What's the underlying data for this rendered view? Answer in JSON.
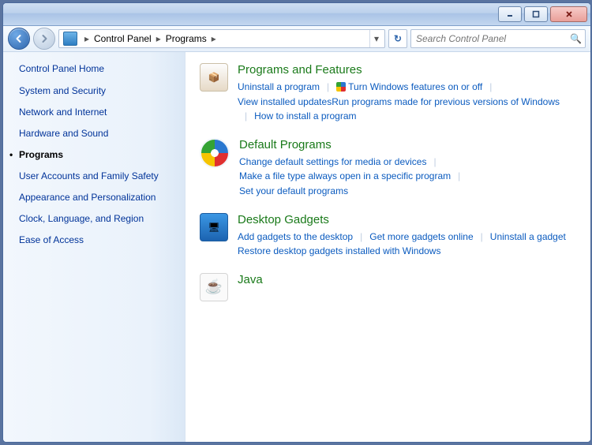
{
  "window": {
    "min_tooltip": "Minimize",
    "max_tooltip": "Maximize",
    "close_tooltip": "Close"
  },
  "breadcrumb": {
    "seg1": "Control Panel",
    "seg2": "Programs"
  },
  "search": {
    "placeholder": "Search Control Panel"
  },
  "sidebar": {
    "home": "Control Panel Home",
    "items": [
      {
        "label": "System and Security"
      },
      {
        "label": "Network and Internet"
      },
      {
        "label": "Hardware and Sound"
      },
      {
        "label": "Programs",
        "current": true
      },
      {
        "label": "User Accounts and Family Safety"
      },
      {
        "label": "Appearance and Personalization"
      },
      {
        "label": "Clock, Language, and Region"
      },
      {
        "label": "Ease of Access"
      }
    ]
  },
  "sections": {
    "programs": {
      "title": "Programs and Features",
      "links": [
        "Uninstall a program",
        "Turn Windows features on or off",
        "View installed updates",
        "Run programs made for previous versions of Windows",
        "How to install a program"
      ]
    },
    "default": {
      "title": "Default Programs",
      "links": [
        "Change default settings for media or devices",
        "Make a file type always open in a specific program",
        "Set your default programs"
      ]
    },
    "gadgets": {
      "title": "Desktop Gadgets",
      "links": [
        "Add gadgets to the desktop",
        "Get more gadgets online",
        "Uninstall a gadget",
        "Restore desktop gadgets installed with Windows"
      ]
    },
    "java": {
      "title": "Java"
    }
  }
}
